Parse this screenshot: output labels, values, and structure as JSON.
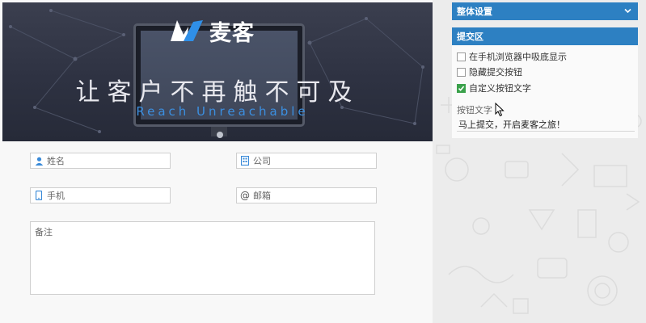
{
  "banner": {
    "brand": "麦客",
    "slogan": "让客户不再触不可及",
    "slogan_en": "Reach Unreachable",
    "accent_color": "#3b8fe0"
  },
  "form": {
    "name_placeholder": "姓名",
    "company_placeholder": "公司",
    "phone_placeholder": "手机",
    "email_placeholder": "邮箱",
    "note_placeholder": "备注"
  },
  "panel": {
    "overall_settings": "整体设置",
    "submit_section": "提交区",
    "header_color": "#2d80c2",
    "options": [
      {
        "label": "在手机浏览器中吸底显示",
        "checked": false
      },
      {
        "label": "隐藏提交按钮",
        "checked": false
      },
      {
        "label": "自定义按钮文字",
        "checked": true
      }
    ],
    "button_text_label": "按钮文字",
    "button_text_value": "马上提交，开启麦客之旅！"
  }
}
